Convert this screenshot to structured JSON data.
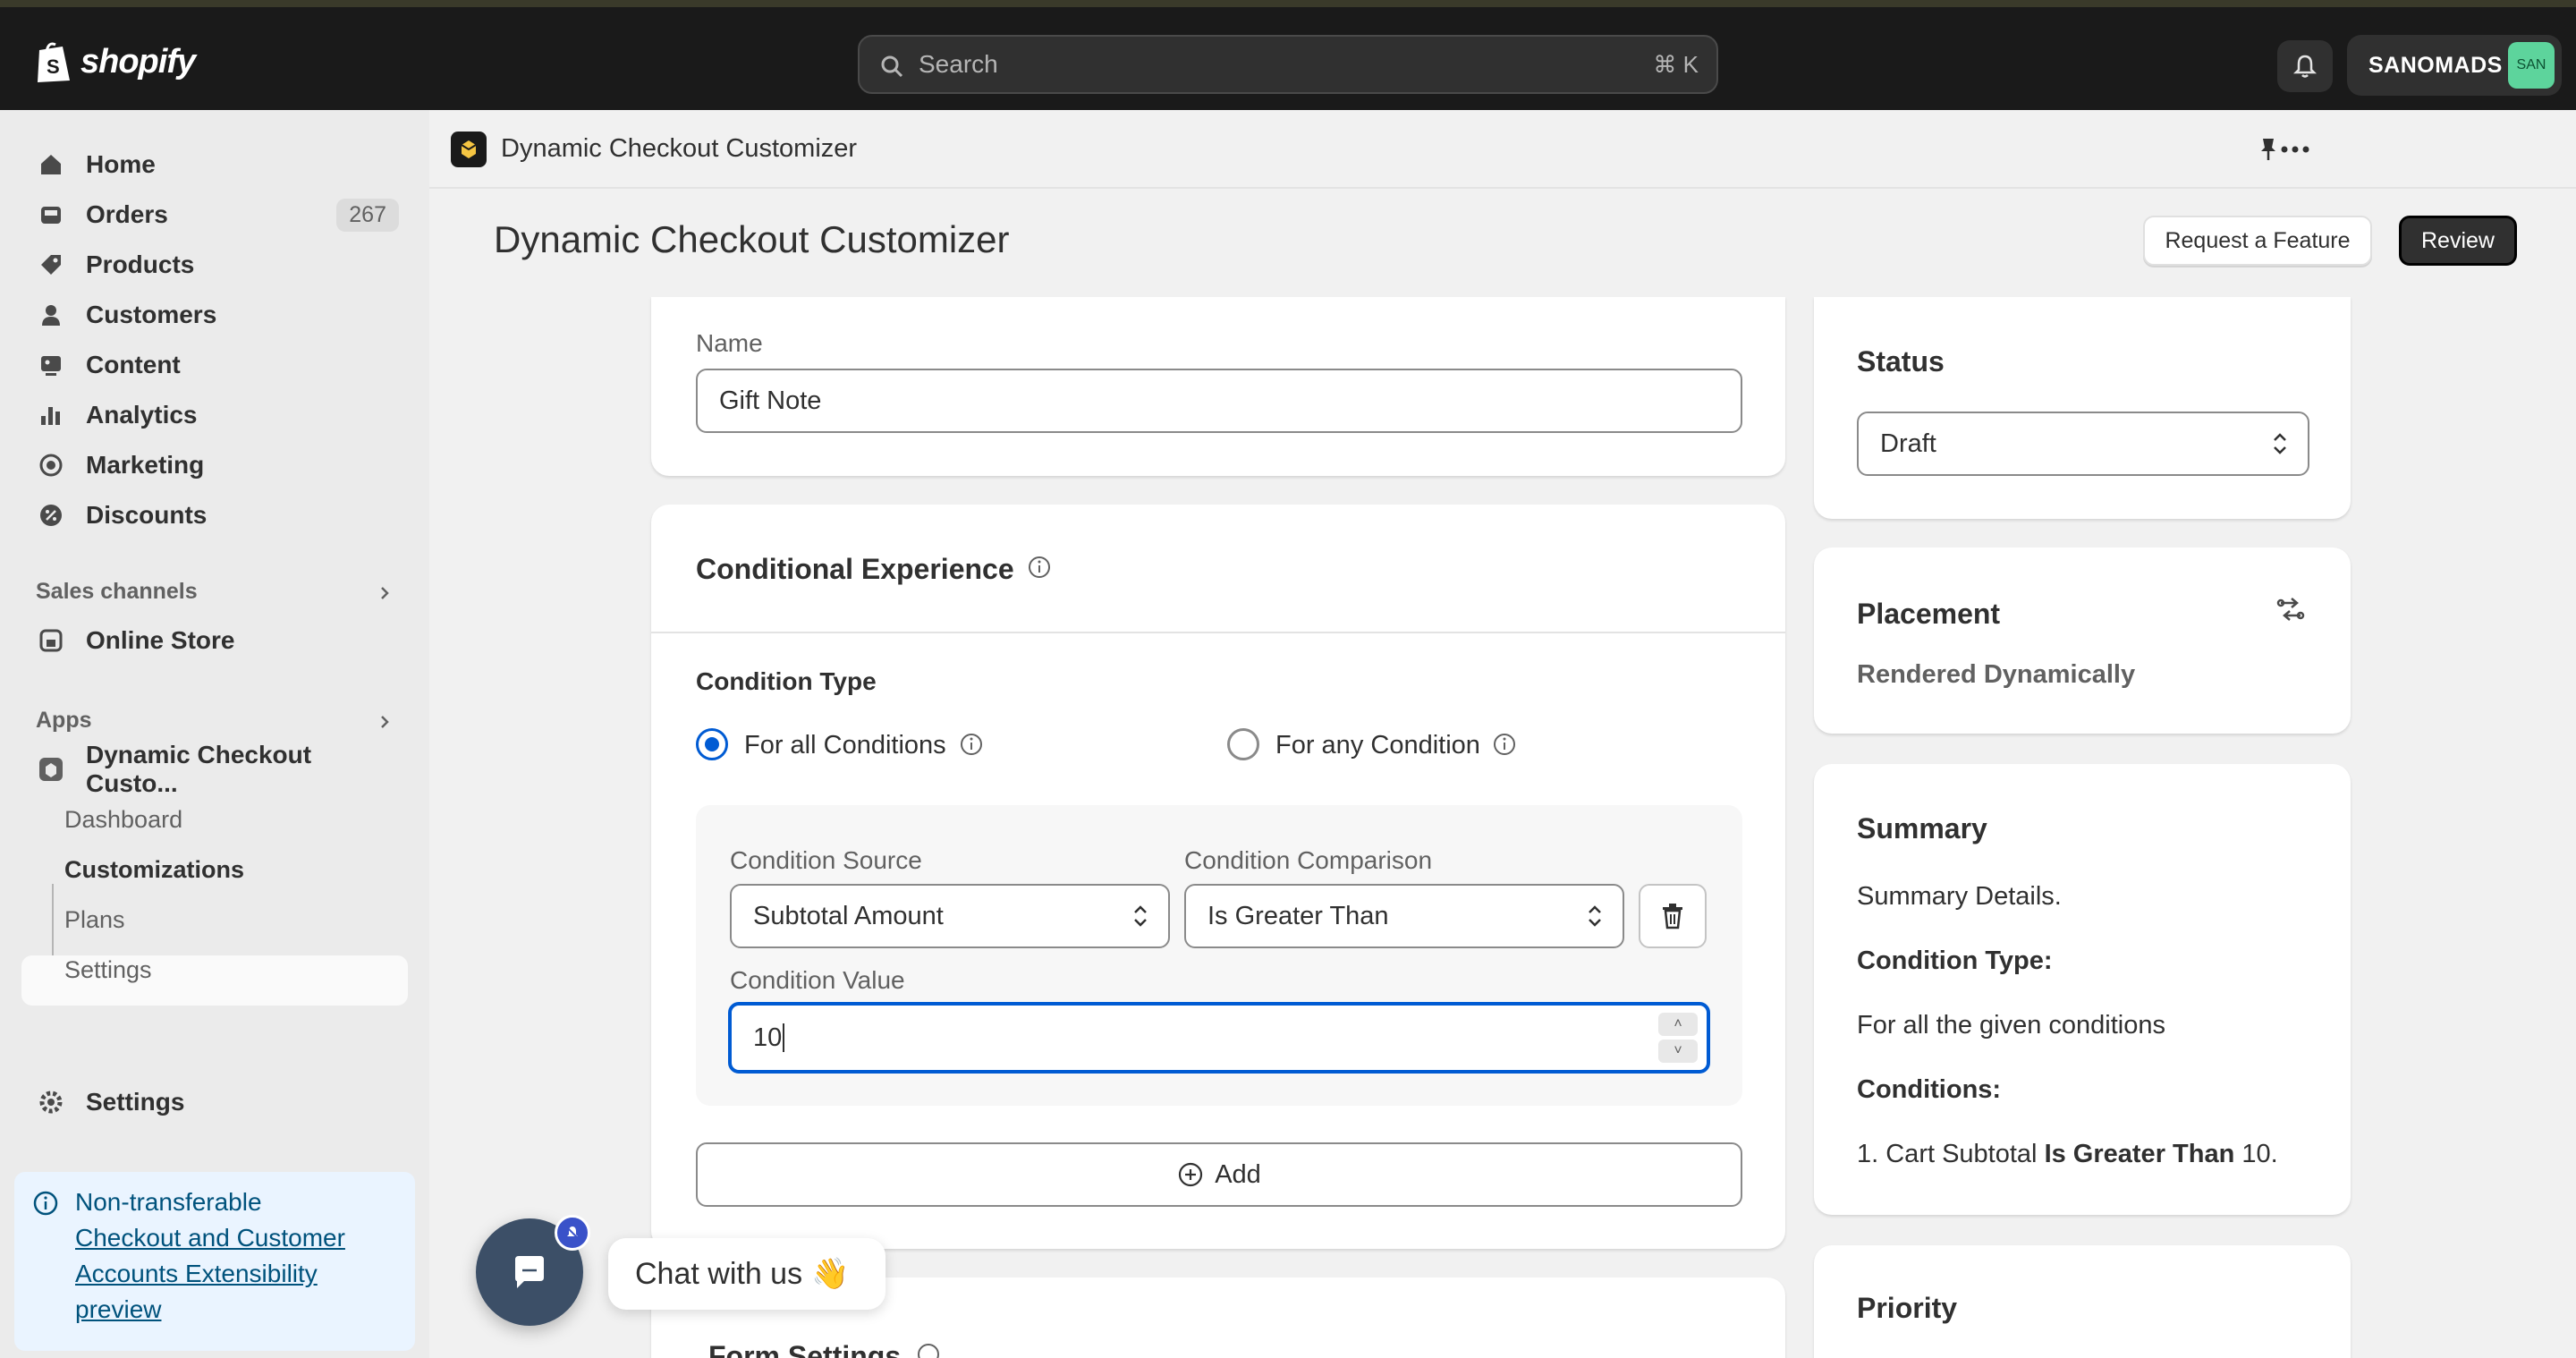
{
  "topbar": {
    "logo_text": "shopify",
    "search_placeholder": "Search",
    "search_shortcut": "⌘ K",
    "store_name": "SANOMADS",
    "store_avatar": "SAN"
  },
  "sidebar": {
    "nav": [
      {
        "label": "Home",
        "icon": "home-icon"
      },
      {
        "label": "Orders",
        "icon": "orders-icon",
        "count": "267"
      },
      {
        "label": "Products",
        "icon": "tag-icon"
      },
      {
        "label": "Customers",
        "icon": "person-icon"
      },
      {
        "label": "Content",
        "icon": "content-icon"
      },
      {
        "label": "Analytics",
        "icon": "bar-chart-icon"
      },
      {
        "label": "Marketing",
        "icon": "target-icon"
      },
      {
        "label": "Discounts",
        "icon": "discount-icon"
      }
    ],
    "sales_channels_label": "Sales channels",
    "online_store": "Online Store",
    "apps_label": "Apps",
    "app_name": "Dynamic Checkout Custo...",
    "app_sub": [
      "Dashboard",
      "Customizations",
      "Plans",
      "Settings"
    ],
    "settings": "Settings",
    "banner": {
      "title": "Non-transferable",
      "link": "Checkout and Customer Accounts Extensibility preview"
    }
  },
  "apphead": {
    "title": "Dynamic Checkout Customizer"
  },
  "page": {
    "title": "Dynamic Checkout Customizer",
    "request_feature": "Request a Feature",
    "review": "Review"
  },
  "form": {
    "name_label": "Name",
    "name_value": "Gift Note",
    "conditional_title": "Conditional Experience",
    "condition_type_label": "Condition Type",
    "radio_all": "For all Conditions",
    "radio_any": "For any Condition",
    "source_label": "Condition Source",
    "source_value": "Subtotal Amount",
    "comparison_label": "Condition Comparison",
    "comparison_value": "Is Greater Than",
    "value_label": "Condition Value",
    "value_value": "10",
    "add_label": "Add",
    "form_settings_title": "Form Settings"
  },
  "status": {
    "title": "Status",
    "value": "Draft"
  },
  "placement": {
    "title": "Placement",
    "value": "Rendered Dynamically"
  },
  "summary": {
    "title": "Summary",
    "details": "Summary Details.",
    "condition_type_label": "Condition Type:",
    "condition_type_value": "For all the given conditions",
    "conditions_label": "Conditions:",
    "line_prefix": "1. Cart Subtotal",
    "line_bold": "Is Greater Than",
    "line_suffix": "10."
  },
  "priority": {
    "title": "Priority"
  },
  "chat": {
    "label": "Chat with us"
  },
  "colors": {
    "accent": "#005bd3",
    "topbar": "#1a1a1a",
    "primary_button": "#303030"
  }
}
